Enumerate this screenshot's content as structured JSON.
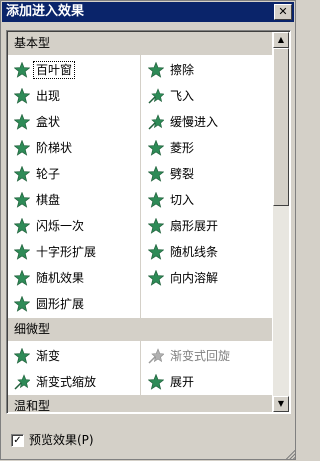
{
  "title": "添加进入效果",
  "close_glyph": "✕",
  "sections": [
    {
      "label": "基本型"
    },
    {
      "label": "细微型"
    },
    {
      "label": "温和型"
    }
  ],
  "basic": {
    "left": [
      "百叶窗",
      "出现",
      "盒状",
      "阶梯状",
      "轮子",
      "棋盘",
      "闪烁一次",
      "十字形扩展",
      "随机效果",
      "圆形扩展"
    ],
    "right": [
      "擦除",
      "飞入",
      "缓慢进入",
      "菱形",
      "劈裂",
      "切入",
      "扇形展开",
      "随机线条",
      "向内溶解"
    ]
  },
  "subtle": {
    "left": [
      "渐变",
      "渐变式缩放"
    ],
    "right": [
      "渐变式回旋",
      "展开"
    ]
  },
  "preview": {
    "label": "预览效果(P)",
    "checked": true,
    "check_glyph": "✓"
  },
  "scroll": {
    "up_glyph": "▲",
    "down_glyph": "▼"
  },
  "colors": {
    "title_bar": "#0a246a",
    "icon_green": "#2e8b57",
    "icon_dark": "#1f5f3a"
  }
}
